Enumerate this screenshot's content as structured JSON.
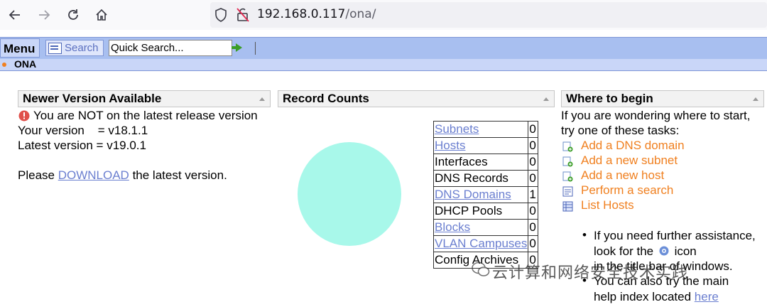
{
  "browser": {
    "url_host": "192.168.0.117",
    "url_path": "/ona/"
  },
  "menubar": {
    "menu_label": "Menu",
    "search_label": "Search",
    "quick_search_value": "Quick Search...",
    "ona_label": "ONA"
  },
  "version_panel": {
    "title": "Newer Version Available",
    "warning": "You are NOT on the latest release version",
    "your_version": "Your version    = v18.1.1",
    "latest_version": "Latest version = v19.0.1",
    "please": "Please",
    "download_link": "DOWNLOAD",
    "suffix": "the latest version."
  },
  "record_panel": {
    "title": "Record Counts",
    "rows": [
      {
        "label": "Subnets",
        "count": "0",
        "link": true
      },
      {
        "label": "Hosts",
        "count": "0",
        "link": true
      },
      {
        "label": "Interfaces",
        "count": "0",
        "link": false
      },
      {
        "label": "DNS Records",
        "count": "0",
        "link": false
      },
      {
        "label": "DNS Domains",
        "count": "1",
        "link": true
      },
      {
        "label": "DHCP Pools",
        "count": "0",
        "link": false
      },
      {
        "label": "Blocks",
        "count": "0",
        "link": true
      },
      {
        "label": "VLAN Campuses",
        "count": "0",
        "link": true
      },
      {
        "label": "Config Archives",
        "count": "0",
        "link": false
      }
    ]
  },
  "begin_panel": {
    "title": "Where to begin",
    "intro1": "If you are wondering where to start,",
    "intro2": "try one of these tasks:",
    "tasks": [
      "Add a DNS domain",
      "Add a new subnet",
      "Add a new host",
      "Perform a search",
      "List Hosts"
    ],
    "bullet1_a": "If you need further assistance,",
    "bullet1_b": "look for the",
    "bullet1_c": "icon",
    "bullet1_d": "in the title bar of windows.",
    "bullet2_a": "You can also try the main",
    "bullet2_b": "help index located",
    "bullet2_link": "here"
  },
  "watermark": "云计算和网络安全技术实践"
}
